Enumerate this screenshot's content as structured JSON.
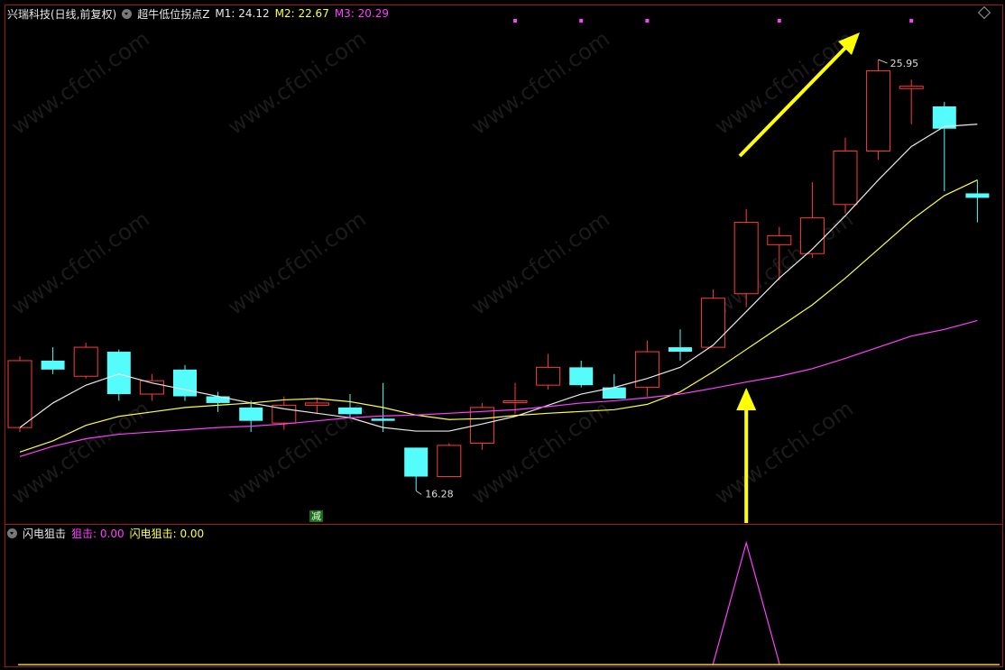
{
  "header": {
    "stock_name": "兴瑞科技(日线,前复权)",
    "indicator_name": "超牛低位拐点Z",
    "m1_label": "M1: 24.12",
    "m2_label": "M2: 22.67",
    "m3_label": "M3: 20.29"
  },
  "subpanel": {
    "name": "闪电狙击",
    "v1_label": "狙击: 0.00",
    "v2_label": "闪电狙击: 0.00"
  },
  "annotations": {
    "high_label": "25.95",
    "low_label": "16.28",
    "badge": "减"
  },
  "watermark": "www.cfchi.com",
  "colors": {
    "up": "#ff3b3b",
    "down": "#54fcfc",
    "m1": "#e8e8e8",
    "m2": "#ffff40",
    "m3": "#ff40ff",
    "arrow": "#ffff00",
    "frame": "#a01818"
  },
  "chart_data": {
    "type": "candlestick",
    "ylim": [
      15.6,
      26.8
    ],
    "candles": [
      {
        "o": 17.7,
        "h": 19.3,
        "l": 17.6,
        "c": 19.2
      },
      {
        "o": 19.2,
        "h": 19.5,
        "l": 18.9,
        "c": 19.0
      },
      {
        "o": 18.85,
        "h": 19.6,
        "l": 18.8,
        "c": 19.5
      },
      {
        "o": 19.4,
        "h": 19.45,
        "l": 18.3,
        "c": 18.45
      },
      {
        "o": 18.45,
        "h": 18.9,
        "l": 18.3,
        "c": 18.75
      },
      {
        "o": 19.0,
        "h": 19.1,
        "l": 18.3,
        "c": 18.4
      },
      {
        "o": 18.4,
        "h": 18.5,
        "l": 18.05,
        "c": 18.25
      },
      {
        "o": 18.15,
        "h": 18.3,
        "l": 17.6,
        "c": 17.85
      },
      {
        "o": 17.8,
        "h": 18.4,
        "l": 17.65,
        "c": 18.2
      },
      {
        "o": 18.2,
        "h": 18.35,
        "l": 18.0,
        "c": 18.25
      },
      {
        "o": 18.15,
        "h": 18.45,
        "l": 17.9,
        "c": 18.0
      },
      {
        "o": 17.9,
        "h": 18.7,
        "l": 17.6,
        "c": 17.85
      },
      {
        "o": 17.25,
        "h": 17.25,
        "l": 16.28,
        "c": 16.6
      },
      {
        "o": 16.6,
        "h": 17.35,
        "l": 16.6,
        "c": 17.3
      },
      {
        "o": 17.35,
        "h": 18.25,
        "l": 17.2,
        "c": 18.15
      },
      {
        "o": 18.3,
        "h": 18.7,
        "l": 18.0,
        "c": 18.3
      },
      {
        "o": 18.65,
        "h": 19.35,
        "l": 18.55,
        "c": 19.05
      },
      {
        "o": 19.05,
        "h": 19.2,
        "l": 18.6,
        "c": 18.65
      },
      {
        "o": 18.6,
        "h": 18.9,
        "l": 18.35,
        "c": 18.35
      },
      {
        "o": 18.6,
        "h": 19.65,
        "l": 18.4,
        "c": 19.4
      },
      {
        "o": 19.5,
        "h": 19.9,
        "l": 19.2,
        "c": 19.4
      },
      {
        "o": 19.5,
        "h": 20.8,
        "l": 19.5,
        "c": 20.6
      },
      {
        "o": 20.7,
        "h": 22.6,
        "l": 20.4,
        "c": 22.3
      },
      {
        "o": 21.8,
        "h": 22.2,
        "l": 21.0,
        "c": 22.0
      },
      {
        "o": 21.6,
        "h": 23.2,
        "l": 21.5,
        "c": 22.4
      },
      {
        "o": 22.7,
        "h": 24.2,
        "l": 22.5,
        "c": 23.9
      },
      {
        "o": 23.9,
        "h": 25.95,
        "l": 23.7,
        "c": 25.7
      },
      {
        "o": 25.3,
        "h": 25.5,
        "l": 24.5,
        "c": 25.35
      },
      {
        "o": 24.9,
        "h": 25.0,
        "l": 23.0,
        "c": 24.4
      },
      {
        "o": 22.95,
        "h": 23.25,
        "l": 22.3,
        "c": 22.85
      }
    ],
    "m1": [
      17.7,
      18.25,
      18.65,
      18.9,
      18.7,
      18.55,
      18.4,
      18.25,
      18.12,
      18.02,
      17.92,
      17.7,
      17.62,
      17.62,
      17.78,
      17.95,
      18.2,
      18.45,
      18.6,
      18.8,
      19.05,
      19.55,
      20.3,
      21.05,
      21.7,
      22.45,
      23.25,
      24.0,
      24.45,
      24.5
    ],
    "m2": [
      17.15,
      17.4,
      17.75,
      17.95,
      18.05,
      18.15,
      18.2,
      18.25,
      18.32,
      18.35,
      18.28,
      18.15,
      17.98,
      17.88,
      17.9,
      17.97,
      18.02,
      18.06,
      18.1,
      18.22,
      18.5,
      18.95,
      19.45,
      19.95,
      20.45,
      21.05,
      21.7,
      22.35,
      22.9,
      23.25
    ],
    "m3": [
      17.05,
      17.28,
      17.45,
      17.55,
      17.6,
      17.65,
      17.7,
      17.73,
      17.78,
      17.85,
      17.92,
      17.96,
      17.98,
      18.02,
      18.06,
      18.1,
      18.17,
      18.25,
      18.3,
      18.37,
      18.45,
      18.58,
      18.72,
      18.85,
      19.02,
      19.25,
      19.5,
      19.75,
      19.9,
      20.1
    ],
    "signal_x": 22,
    "signal_dots_x": [
      15,
      17,
      19,
      23,
      27
    ]
  }
}
